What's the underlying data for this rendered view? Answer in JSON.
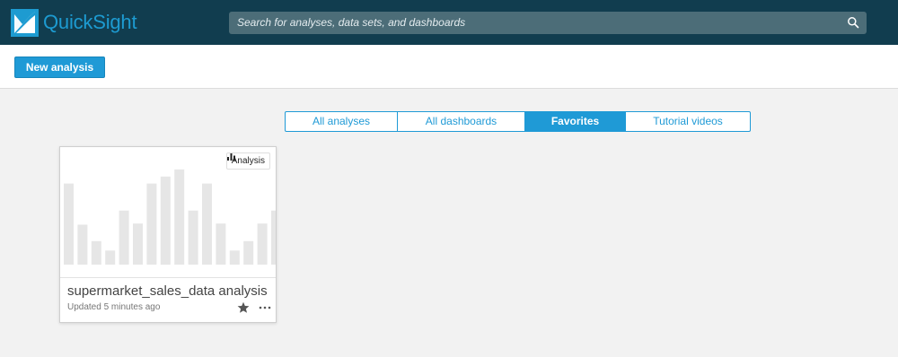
{
  "app": {
    "name": "QuickSight"
  },
  "search": {
    "placeholder": "Search for analyses, data sets, and dashboards"
  },
  "toolbar": {
    "new_analysis_label": "New analysis"
  },
  "tabs": [
    {
      "label": "All analyses",
      "active": false
    },
    {
      "label": "All dashboards",
      "active": false
    },
    {
      "label": "Favorites",
      "active": true
    },
    {
      "label": "Tutorial videos",
      "active": false
    }
  ],
  "cards": [
    {
      "title": "supermarket_sales_data analysis",
      "updated": "Updated 5 minutes ago",
      "type_badge": "Analysis",
      "favorited": true,
      "thumbnail_bars": [
        0.69,
        0.34,
        0.2,
        0.12,
        0.46,
        0.35,
        0.69,
        0.75,
        0.81,
        0.46,
        0.69,
        0.35,
        0.12,
        0.2,
        0.35,
        0.46
      ]
    }
  ],
  "colors": {
    "brand": "#1d9bd1",
    "header_bg": "#113d4f",
    "accent": "#1f9ad6"
  }
}
